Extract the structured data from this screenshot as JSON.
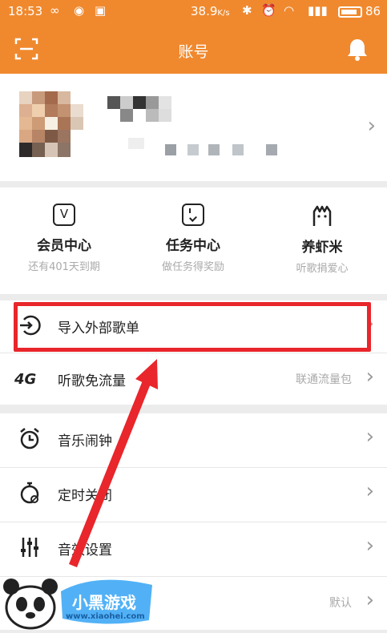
{
  "status_bar": {
    "time": "18:53",
    "speed": "38.9",
    "speed_unit": "K/s",
    "battery": "86",
    "battery_level": 0.86
  },
  "header": {
    "title": "账号"
  },
  "quick_actions": [
    {
      "label": "会员中心",
      "sub": "还有401天到期",
      "icon": "V"
    },
    {
      "label": "任务中心",
      "sub": "做任务得奖励",
      "icon": "task"
    },
    {
      "label": "养虾米",
      "sub": "听歌捐爱心",
      "icon": "shrimp"
    }
  ],
  "rows": {
    "import": {
      "label": "导入外部歌单"
    },
    "free_data": {
      "label": "听歌免流量",
      "right": "联通流量包",
      "badge": "4G"
    },
    "alarm": {
      "label": "音乐闹钟"
    },
    "timer": {
      "label": "定时关闭"
    },
    "sound": {
      "label": "音效设置"
    },
    "last": {
      "right": "默认"
    }
  },
  "watermark": {
    "site": "www.xiaohei.com",
    "brand": "小黑游戏"
  },
  "colors": {
    "accent": "#f0892e",
    "highlight": "#e8262b"
  }
}
